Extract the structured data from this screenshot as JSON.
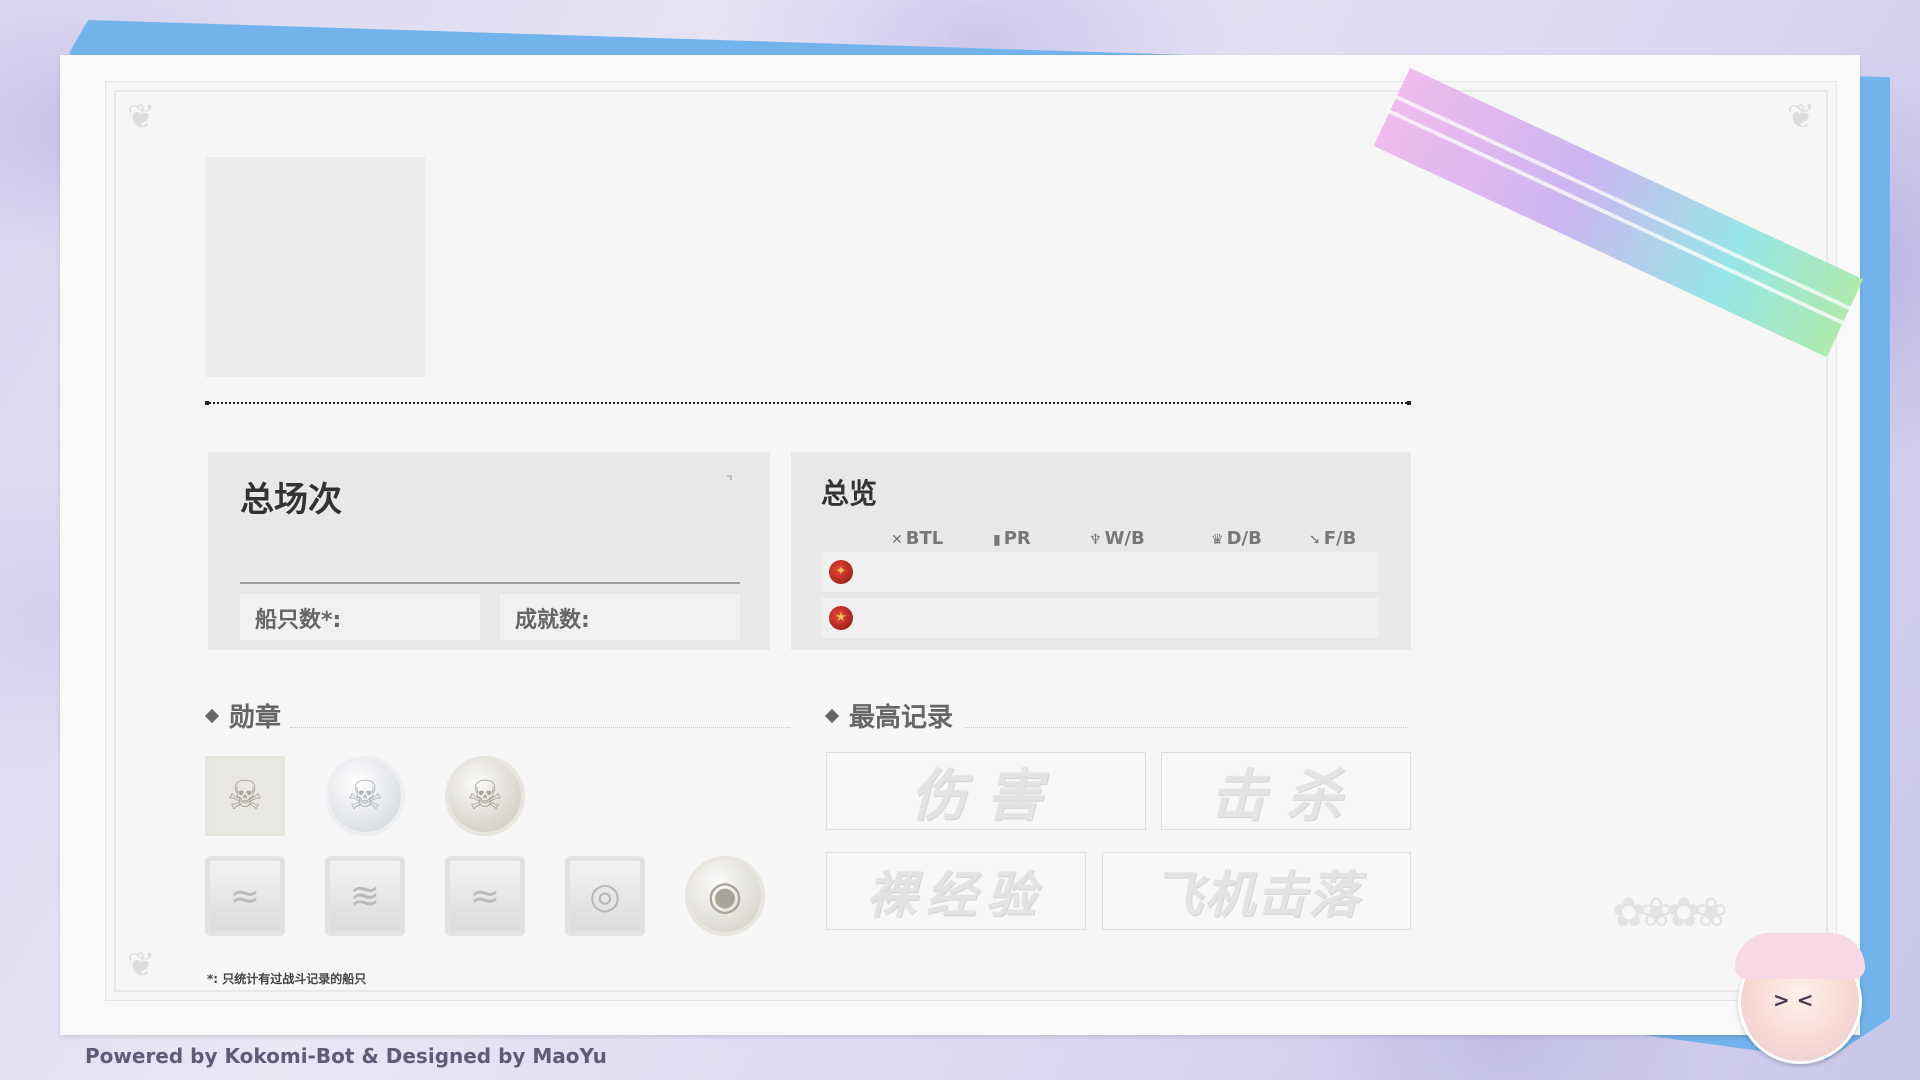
{
  "overall": {
    "title": "总场次",
    "ships_label": "船只数*:",
    "achievements_label": "成就数:"
  },
  "overview": {
    "title": "总览",
    "headers": [
      {
        "icon": "✕",
        "label": "BTL"
      },
      {
        "icon": "▮",
        "label": "PR"
      },
      {
        "icon": "♆",
        "label": "W/B"
      },
      {
        "icon": "♛",
        "label": "D/B"
      },
      {
        "icon": "➘",
        "label": "F/B"
      }
    ],
    "rows": [
      {
        "badge_color": "#c62a2a"
      },
      {
        "badge_color": "#c62a2a"
      }
    ]
  },
  "medals": {
    "title": "勋章",
    "row1": [
      {
        "icon": "skull-medal-icon",
        "glyph": "☠"
      },
      {
        "icon": "skull-medal-icon",
        "glyph": "☠"
      },
      {
        "icon": "skull-medal-icon",
        "glyph": "☠"
      }
    ],
    "row2": [
      {
        "icon": "wave-medal-icon",
        "glyph": "≈"
      },
      {
        "icon": "wave-medal-icon",
        "glyph": "≋"
      },
      {
        "icon": "wave-medal-icon",
        "glyph": "≈"
      },
      {
        "icon": "swirl-medal-icon",
        "glyph": "◎"
      },
      {
        "icon": "swirl-medal-icon",
        "glyph": "◉"
      }
    ]
  },
  "records": {
    "title": "最高记录",
    "items": [
      "伤害",
      "击杀",
      "裸经验",
      "飞机击落"
    ]
  },
  "footnote": "*: 只统计有过战斗记录的船只",
  "footer": "Powered by Kokomi-Bot & Designed by MaoYu"
}
